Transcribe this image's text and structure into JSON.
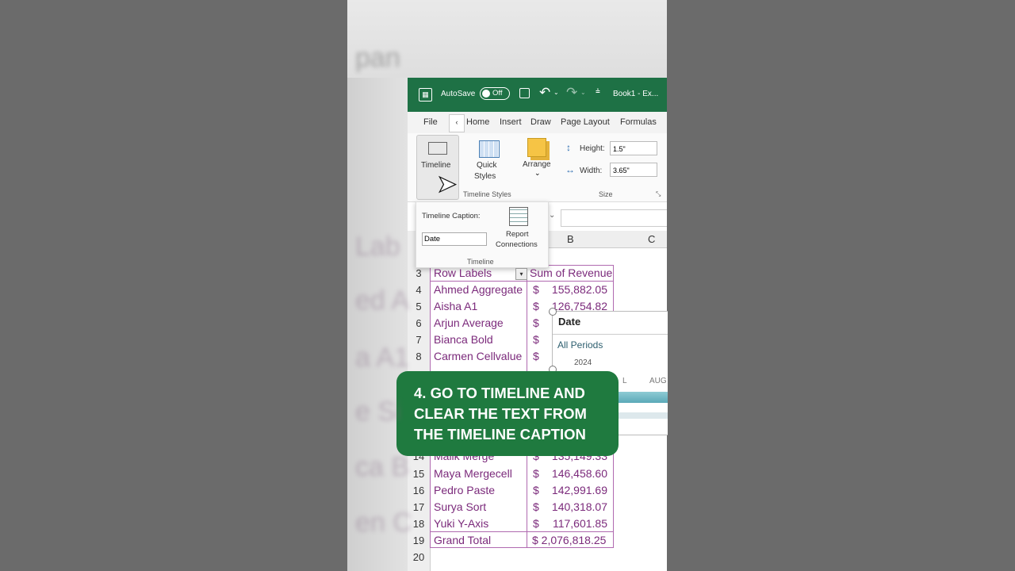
{
  "backdrop": {
    "ghost_lines": [
      "Lab",
      "ed A",
      "a A1",
      "e Si",
      "ca B",
      "en C",
      "pan"
    ]
  },
  "titlebar": {
    "autosave": "AutoSave",
    "toggle": "Off",
    "book": "Book1  -  Ex..."
  },
  "tabs": [
    "File",
    "Home",
    "Insert",
    "Draw",
    "Page Layout",
    "Formulas"
  ],
  "ribbon": {
    "timeline_btn": "Timeline",
    "quick_styles": "Quick",
    "quick_styles2": "Styles",
    "timeline_styles": "Timeline Styles",
    "arrange": "Arrange",
    "height_label": "Height:",
    "height_val": "1.5\"",
    "width_label": "Width:",
    "width_val": "3.65\"",
    "size_label": "Size"
  },
  "panel": {
    "caption_label": "Timeline Caption:",
    "caption_value": "Date",
    "report1": "Report",
    "report2": "Connections",
    "group": "Timeline"
  },
  "columns": {
    "b": "B",
    "c": "C"
  },
  "pivot": {
    "header_a": "Row Labels",
    "header_b": "Sum of Revenue",
    "rows": [
      {
        "n": "4",
        "name": "Ahmed Aggregate",
        "amt": "155,882.05"
      },
      {
        "n": "5",
        "name": "Aisha A1",
        "amt": "126,754.82"
      },
      {
        "n": "6",
        "name": "Arjun Average",
        "amt": ""
      },
      {
        "n": "7",
        "name": "Bianca Bold",
        "amt": ""
      },
      {
        "n": "8",
        "name": "Carmen Cellvalue",
        "amt": ""
      },
      {
        "n": "14",
        "name": "Malik Merge",
        "amt": "135,149.33"
      },
      {
        "n": "15",
        "name": "Maya Mergecell",
        "amt": "146,458.60"
      },
      {
        "n": "16",
        "name": "Pedro Paste",
        "amt": "142,991.69"
      },
      {
        "n": "17",
        "name": "Surya Sort",
        "amt": "140,318.07"
      },
      {
        "n": "18",
        "name": "Yuki Y-Axis",
        "amt": "117,601.85"
      }
    ],
    "total_label": "Grand Total",
    "total_amt": "$ 2,076,818.25",
    "row3": "3",
    "row19": "19",
    "row20": "20",
    "dollar": "$"
  },
  "slicer": {
    "title": "Date",
    "periods": "All Periods",
    "year": "2024",
    "month1": "L",
    "month2": "AUG"
  },
  "caption": {
    "line1": "4. GO TO TIMELINE AND",
    "line2": "CLEAR THE TEXT FROM",
    "line3": "THE TIMELINE CAPTION"
  },
  "colors": {
    "excel_green": "#1e7145",
    "caption_green": "#1f7a3f",
    "pivot_text": "#7b2a7b"
  }
}
